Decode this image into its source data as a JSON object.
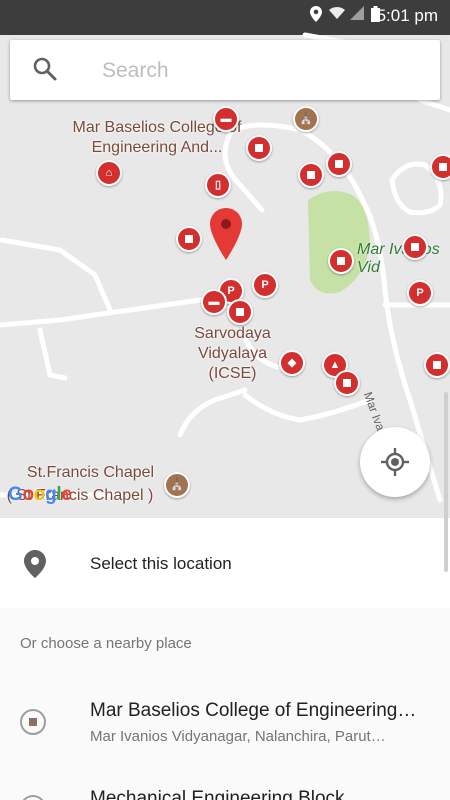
{
  "status_bar": {
    "time": "5:01 pm",
    "icons": [
      "location-icon",
      "wifi-icon",
      "signal-icon",
      "battery-icon"
    ]
  },
  "search": {
    "placeholder": "Search",
    "icon": "search-icon"
  },
  "map": {
    "labels": {
      "college": "Mar Baselios College of Engineering And...",
      "school": "Sarvodaya Vidyalaya (ICSE)",
      "chapel": "St.Francis Chapel",
      "chapel_sub": "( St Francis Chapel )",
      "park": "Mar Ivanios Vid",
      "road": "Mar Ivanios Colle",
      "sidetext_top": "r"
    },
    "google_logo": "Google",
    "my_location_icon": "my-location-icon"
  },
  "panel": {
    "select_location": "Select this location",
    "nearby_heading": "Or choose a nearby place",
    "places": [
      {
        "name": "Mar Baselios College of Engineering…",
        "address": "Mar Ivanios Vidyanagar, Nalanchira, Parut…"
      },
      {
        "name": "Mechanical Engineering Block",
        "address": ""
      }
    ]
  },
  "colors": {
    "poi_red": "#d32f2f",
    "park_green": "#c5e1a5",
    "accent_brown": "#8d6e63"
  }
}
